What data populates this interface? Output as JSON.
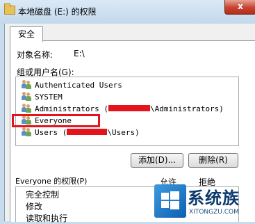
{
  "window": {
    "title": "本地磁盘 (E:) 的权限",
    "close_glyph": "x",
    "accent_close": "#c7422f"
  },
  "tabs": [
    {
      "label": "安全"
    }
  ],
  "security": {
    "object_label": "对象名称:",
    "object_value": "E:\\",
    "groups_label": "组或用户名(G):",
    "users": [
      {
        "icon": "users-icon",
        "name": "Authenticated Users"
      },
      {
        "icon": "users-icon",
        "name": "SYSTEM"
      },
      {
        "icon": "users-icon",
        "name_prefix": "Administrators (",
        "name_suffix": "\\Administrators)"
      },
      {
        "icon": "users-icon",
        "name": "Everyone",
        "highlighted": true
      },
      {
        "icon": "users-icon",
        "name_prefix": "Users (",
        "name_suffix": "\\Users)"
      }
    ],
    "highlight_color": "#e4141c",
    "add_button": "添加(D)...",
    "remove_button": "删除(R)",
    "permissions_label": "Everyone 的权限(P)",
    "allow_header": "允许",
    "deny_header": "拒绝",
    "permissions": [
      {
        "name": "完全控制"
      },
      {
        "name": "修改"
      },
      {
        "name": "读取和执行"
      }
    ]
  },
  "watermark": {
    "text": "系统族",
    "url": "XITONGZU.COM"
  }
}
